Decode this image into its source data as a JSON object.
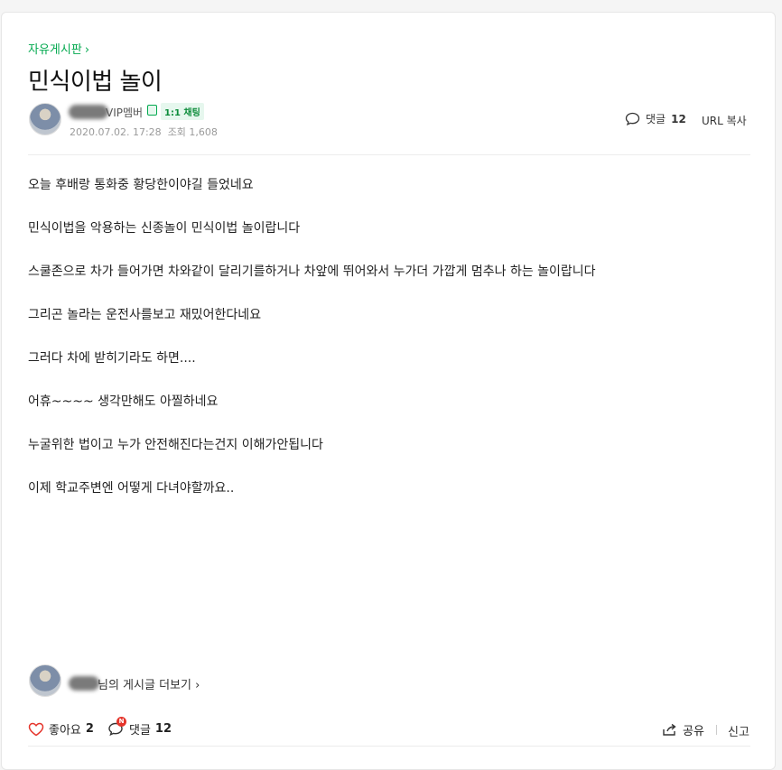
{
  "board": {
    "name": "자유게시판",
    "chevron": "›"
  },
  "post": {
    "title": "민식이법 놀이",
    "author_role": "VIP멤버",
    "chat_badge": "1:1 채팅",
    "date": "2020.07.02. 17:28",
    "views_label": "조회 1,608",
    "comment_label": "댓글",
    "comment_count": "12",
    "url_copy": "URL 복사",
    "paragraphs": [
      "오늘 후배랑 통화중 황당한이야길 들었네요",
      "민식이법을 악용하는 신종놀이 민식이법 놀이랍니다",
      "스쿨존으로 차가 들어가면 차와같이 달리기를하거나 차앞에 뛰어와서 누가더 가깝게 멈추나 하는 놀이랍니다",
      "그리곤 놀라는 운전사를보고 재밌어한다네요",
      "그러다 차에 받히기라도 하면....",
      "어휴~~~~ 생각만해도 아찔하네요",
      "누굴위한 법이고 누가 안전해진다는건지 이해가안됩니다",
      "이제 학교주변엔 어떻게 다녀야할까요.."
    ]
  },
  "footer": {
    "more_posts": "님의 게시글 더보기 ›",
    "like_label": "좋아요",
    "like_count": "2",
    "comment_label": "댓글",
    "comment_count": "12",
    "new_badge": "N",
    "share_label": "공유",
    "report_label": "신고"
  },
  "icons": {
    "comment": "speech-bubble-icon",
    "heart": "heart-outline-icon",
    "share": "share-arrow-icon"
  },
  "colors": {
    "accent": "#03a94f",
    "heart": "#e5352c",
    "badge": "#e5352c"
  }
}
